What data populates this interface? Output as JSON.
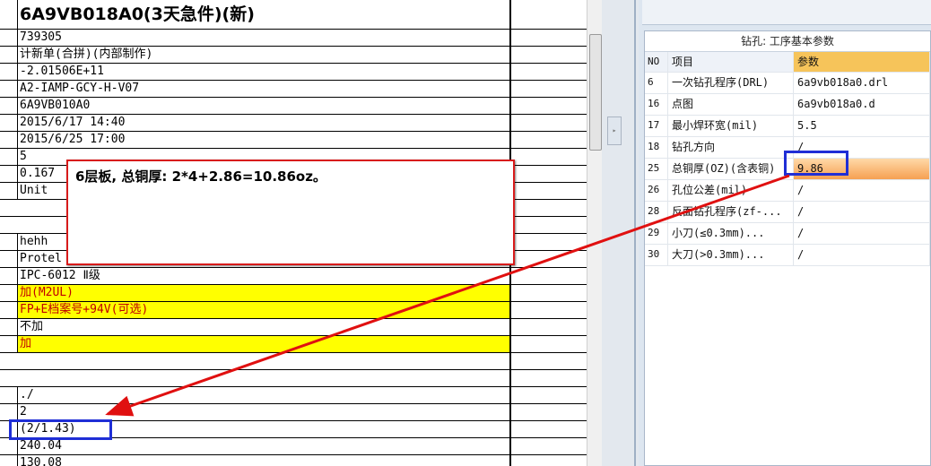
{
  "sheet": {
    "rows": [
      {
        "text": "6A9VB018A0(3天急件)(新)",
        "style": "title"
      },
      {
        "text": "739305",
        "style": ""
      },
      {
        "text": "计新单(合拼)(内部制作)",
        "style": ""
      },
      {
        "text": "-2.01506E+11",
        "style": ""
      },
      {
        "text": "A2-IAMP-GCY-H-V07",
        "style": ""
      },
      {
        "text": "6A9VB010A0",
        "style": ""
      },
      {
        "text": "2015/6/17 14:40",
        "style": ""
      },
      {
        "text": "2015/6/25 17:00",
        "style": ""
      },
      {
        "text": "5",
        "style": ""
      },
      {
        "text": "0.167",
        "style": ""
      },
      {
        "text": "Unit",
        "style": ""
      },
      {
        "text": "",
        "style": "empty"
      },
      {
        "text": "",
        "style": "empty"
      },
      {
        "text": "hehh",
        "style": ""
      },
      {
        "text": "Protel",
        "style": ""
      },
      {
        "text": "IPC-6012 Ⅱ级",
        "style": ""
      },
      {
        "text": "加(M2UL)",
        "style": "yellow"
      },
      {
        "text": "FP+E档案号+94V(可选)",
        "style": "yellow"
      },
      {
        "text": "不加",
        "style": ""
      },
      {
        "text": "加",
        "style": "yellow"
      },
      {
        "text": "",
        "style": "empty"
      },
      {
        "text": "",
        "style": "empty"
      },
      {
        "text": "./",
        "style": ""
      },
      {
        "text": "2",
        "style": ""
      },
      {
        "text": "(2/1.43)",
        "style": ""
      },
      {
        "text": "240.04",
        "style": ""
      },
      {
        "text": "130.08",
        "style": ""
      }
    ]
  },
  "panel": {
    "title": "钻孔: 工序基本参数",
    "headers": {
      "no": "NO",
      "item": "项目",
      "value": "参数"
    },
    "rows": [
      {
        "no": "6",
        "item": "一次钻孔程序(DRL)",
        "value": "6a9vb018a0.drl"
      },
      {
        "no": "16",
        "item": "点图",
        "value": "6a9vb018a0.d"
      },
      {
        "no": "17",
        "item": "最小焊环宽(mil)",
        "value": "5.5"
      },
      {
        "no": "18",
        "item": "钻孔方向",
        "value": "/"
      },
      {
        "no": "25",
        "item": "总铜厚(OZ)(含表铜)",
        "value": "9.86"
      },
      {
        "no": "26",
        "item": "孔位公差(mil)",
        "value": "/"
      },
      {
        "no": "28",
        "item": "反面钻孔程序(zf-...",
        "value": "/"
      },
      {
        "no": "29",
        "item": "小刀(≤0.3mm)...",
        "value": "/"
      },
      {
        "no": "30",
        "item": "大刀(>0.3mm)...",
        "value": "/"
      }
    ]
  },
  "annotation": {
    "note": "6层板, 总铜厚: 2*4+2.86=10.86oz。"
  },
  "colors": {
    "highlight_border": "#1f2ed6",
    "note_border": "#d81b1b",
    "arrow": "#e01010",
    "yellow_fill": "#ffff00"
  }
}
